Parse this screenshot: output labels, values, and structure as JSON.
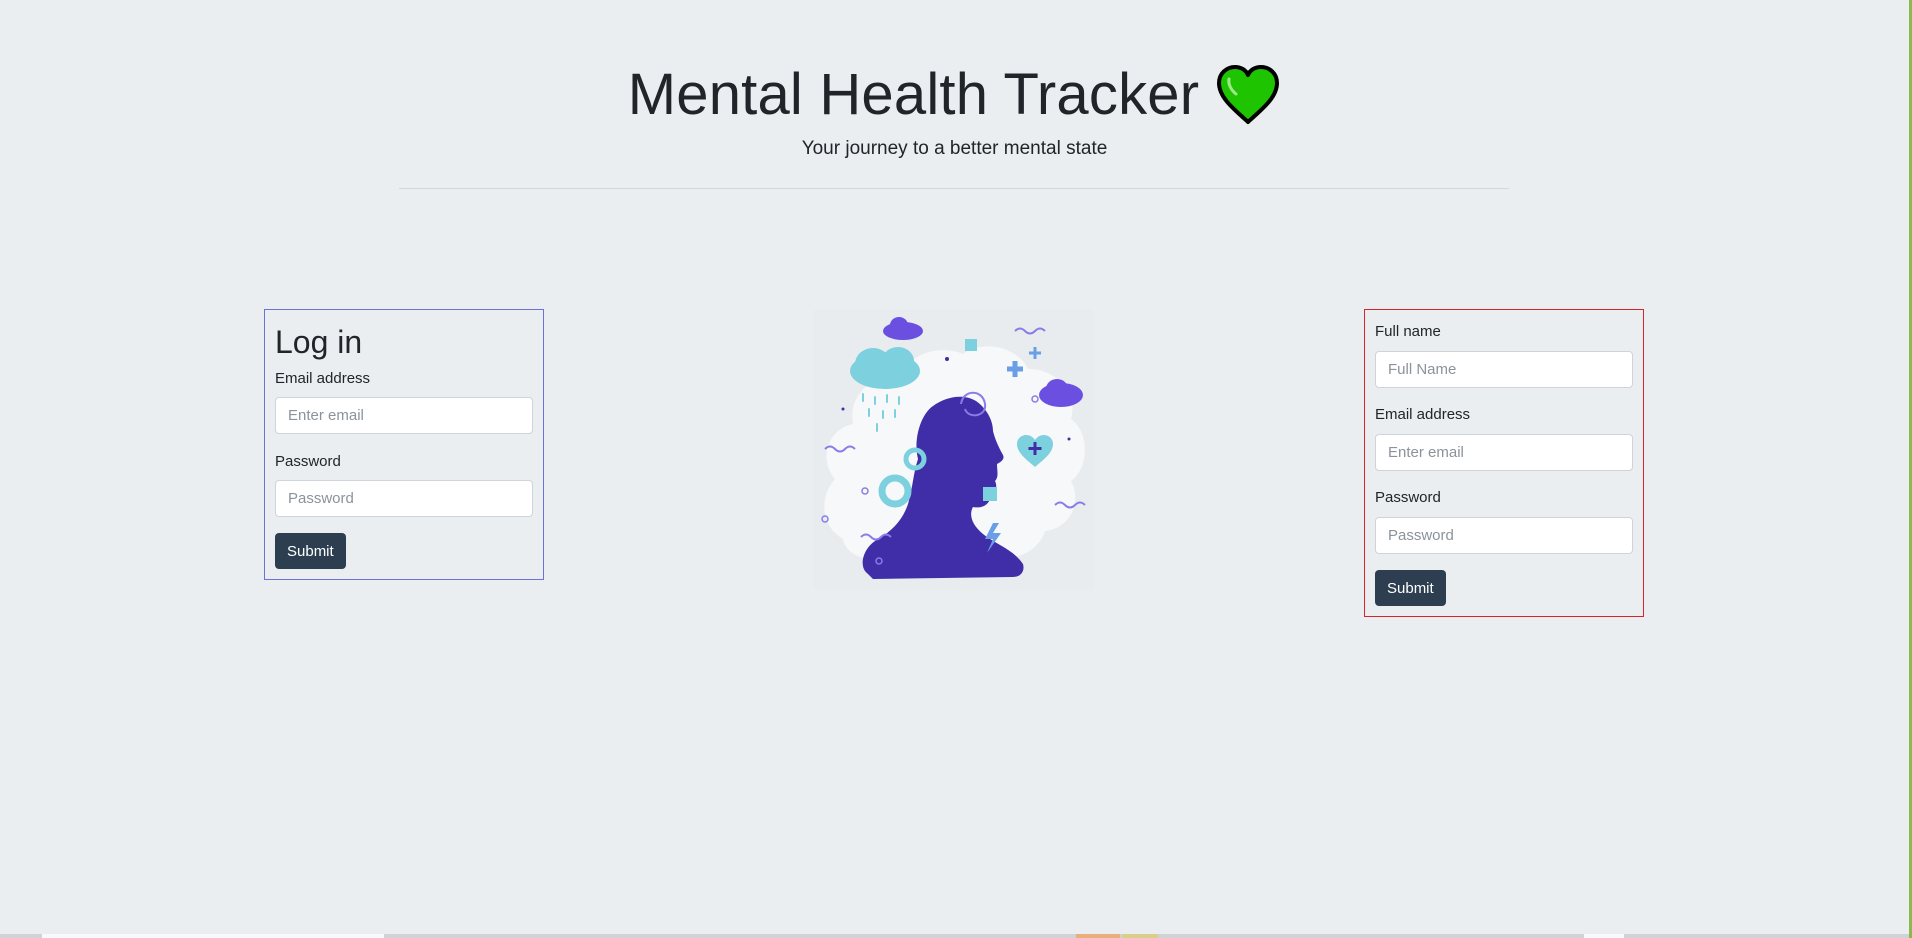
{
  "header": {
    "title": "Mental Health Tracker",
    "subtitle": "Your journey to a better mental state",
    "title_icon": "green-heart-icon"
  },
  "login": {
    "heading": "Log in",
    "email_label": "Email address",
    "email_placeholder": "Enter email",
    "password_label": "Password",
    "password_placeholder": "Password",
    "submit_label": "Submit"
  },
  "signup": {
    "name_label": "Full name",
    "name_placeholder": "Full Name",
    "email_label": "Email address",
    "email_placeholder": "Enter email",
    "password_label": "Password",
    "password_placeholder": "Password",
    "submit_label": "Submit"
  },
  "illustration": {
    "icon": "mind-head-illustration"
  },
  "colors": {
    "background": "#ebeef0",
    "button": "#2c3e50",
    "login_border": "#6c72d9",
    "signup_border": "#d9232a",
    "heart": "#1fc400",
    "illustration_primary": "#3f2ea8",
    "illustration_accent": "#7dd0dd"
  }
}
